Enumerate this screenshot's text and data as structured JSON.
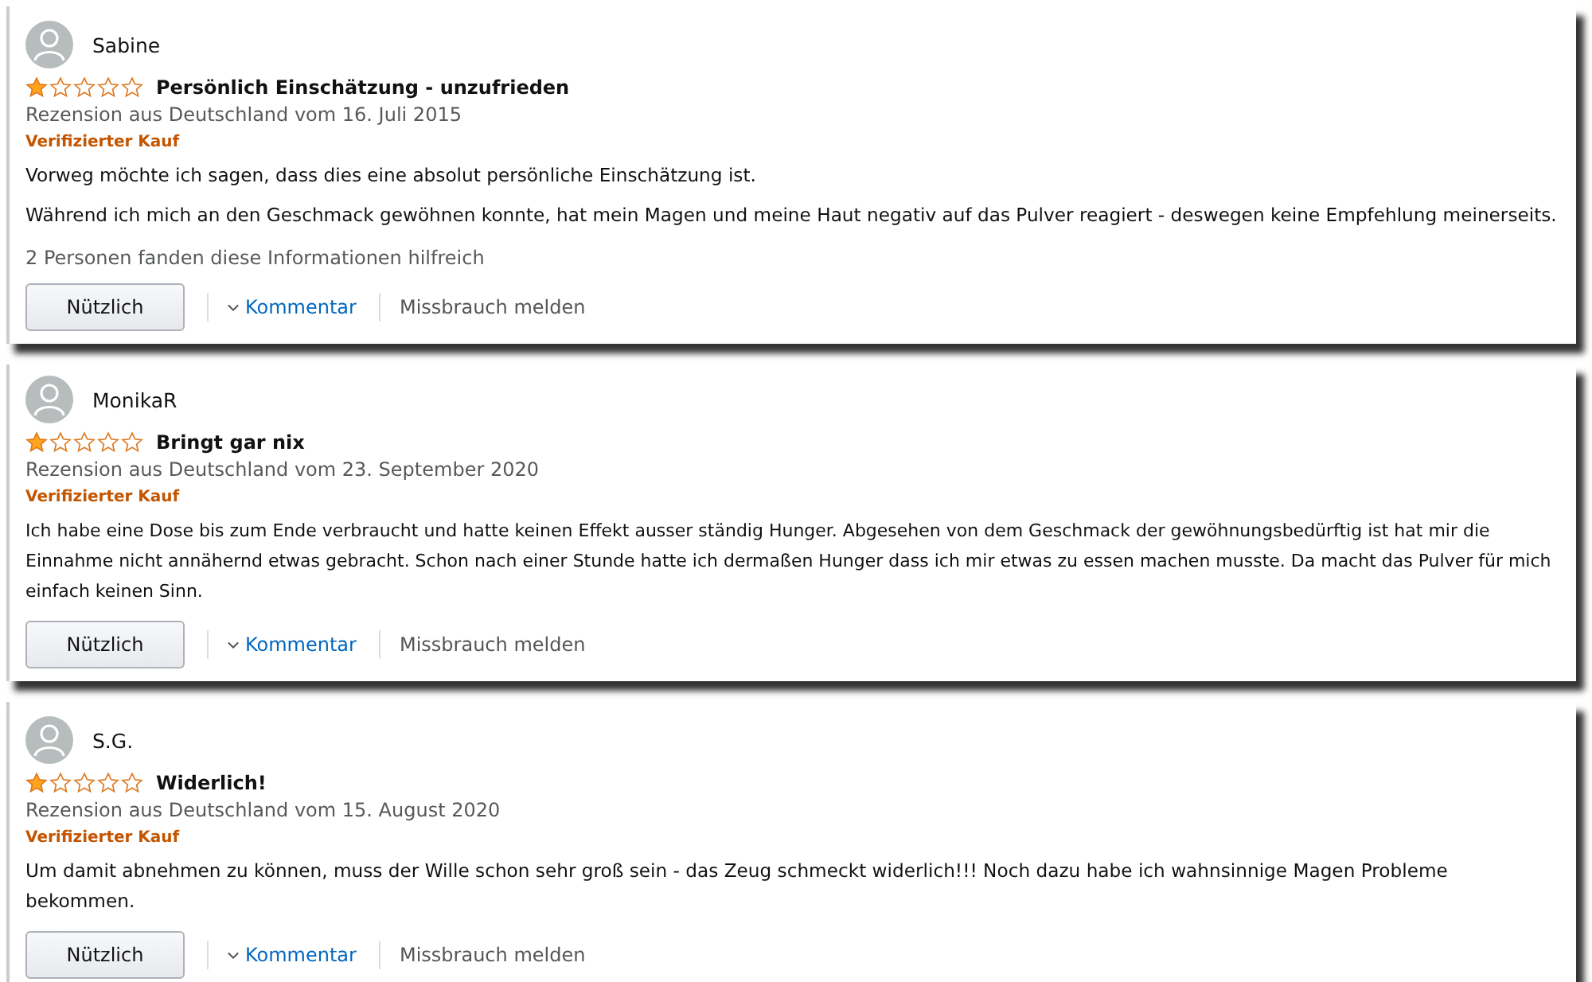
{
  "reviews": [
    {
      "author": "Sabine",
      "stars": 1,
      "title": "Persönlich Einschätzung - unzufrieden",
      "date": "Rezension aus Deutschland vom 16. Juli 2015",
      "badge": "Verifizierter Kauf",
      "body": [
        "Vorweg möchte ich sagen, dass dies eine absolut persönliche Einschätzung ist.",
        "Während ich mich an den Geschmack gewöhnen konnte, hat mein Magen und meine Haut negativ auf das Pulver reagiert - deswegen keine Empfehlung meinerseits."
      ],
      "helpful": "2 Personen fanden diese Informationen hilfreich",
      "helpful_button": "Nützlich",
      "comment_link": "Kommentar",
      "report_link": "Missbrauch melden"
    },
    {
      "author": "MonikaR",
      "stars": 1,
      "title": "Bringt gar nix",
      "date": "Rezension aus Deutschland vom 23. September 2020",
      "badge": "Verifizierter Kauf",
      "body": [
        "Ich habe eine Dose bis zum Ende verbraucht und hatte keinen Effekt ausser ständig Hunger. Abgesehen von dem Geschmack der gewöhnungsbedürftig ist hat mir die Einnahme nicht annähernd etwas gebracht. Schon nach einer Stunde hatte ich dermaßen Hunger dass ich mir etwas zu essen machen musste. Da macht das Pulver für mich einfach keinen Sinn."
      ],
      "helpful_button": "Nützlich",
      "comment_link": "Kommentar",
      "report_link": "Missbrauch melden"
    },
    {
      "author": "S.G.",
      "stars": 1,
      "title": "Widerlich!",
      "date": "Rezension aus Deutschland vom 15. August 2020",
      "badge": "Verifizierter Kauf",
      "body": [
        "Um damit abnehmen zu können, muss der Wille schon sehr groß sein - das Zeug schmeckt widerlich!!! Noch dazu habe ich wahnsinnige Magen Probleme bekommen."
      ],
      "helpful_button": "Nützlich",
      "comment_link": "Kommentar",
      "report_link": "Missbrauch melden"
    }
  ]
}
